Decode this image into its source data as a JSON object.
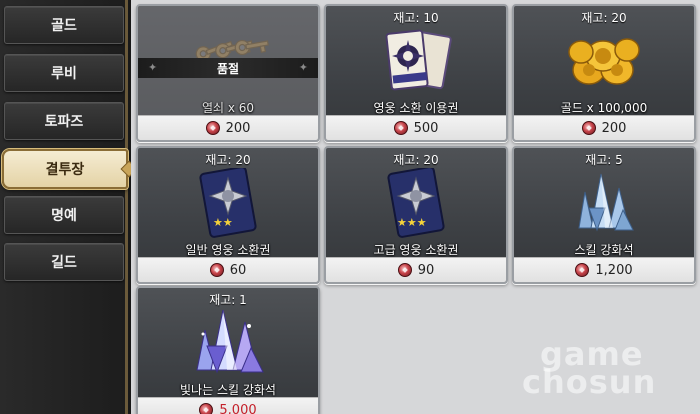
{
  "sidebar": {
    "tabs": [
      {
        "label": "골드"
      },
      {
        "label": "루비"
      },
      {
        "label": "토파즈"
      },
      {
        "label": "결투장",
        "active": true
      },
      {
        "label": "명예"
      },
      {
        "label": "길드"
      }
    ]
  },
  "shop": {
    "currency_icon": "duel-medal-icon",
    "items": [
      {
        "stock": "",
        "name": "열쇠 x 60",
        "price": "200",
        "soldout_label": "품절",
        "icon": "keys-icon",
        "sold_out": true
      },
      {
        "stock": "재고: 10",
        "name": "영웅 소환 이용권",
        "price": "500",
        "icon": "summon-tickets-icon"
      },
      {
        "stock": "재고: 20",
        "name": "골드 x 100,000",
        "price": "200",
        "icon": "gold-coins-icon"
      },
      {
        "stock": "재고: 20",
        "name": "일반 영웅 소환권",
        "price": "60",
        "icon": "summon-card-2star-icon"
      },
      {
        "stock": "재고: 20",
        "name": "고급 영웅 소환권",
        "price": "90",
        "icon": "summon-card-3star-icon"
      },
      {
        "stock": "재고: 5",
        "name": "스킬 강화석",
        "price": "1,200",
        "icon": "skill-crystal-icon"
      },
      {
        "stock": "재고: 1",
        "name": "빛나는 스킬 강화석",
        "price": "5,000",
        "icon": "shining-crystal-icon",
        "price_unaffordable": true
      }
    ]
  },
  "watermark": {
    "line1": "game",
    "line2": "chosun"
  },
  "colors": {
    "active_tab": "#e4d3a6",
    "unaffordable_price": "#c4202a",
    "panel": "#d6d7d9"
  }
}
